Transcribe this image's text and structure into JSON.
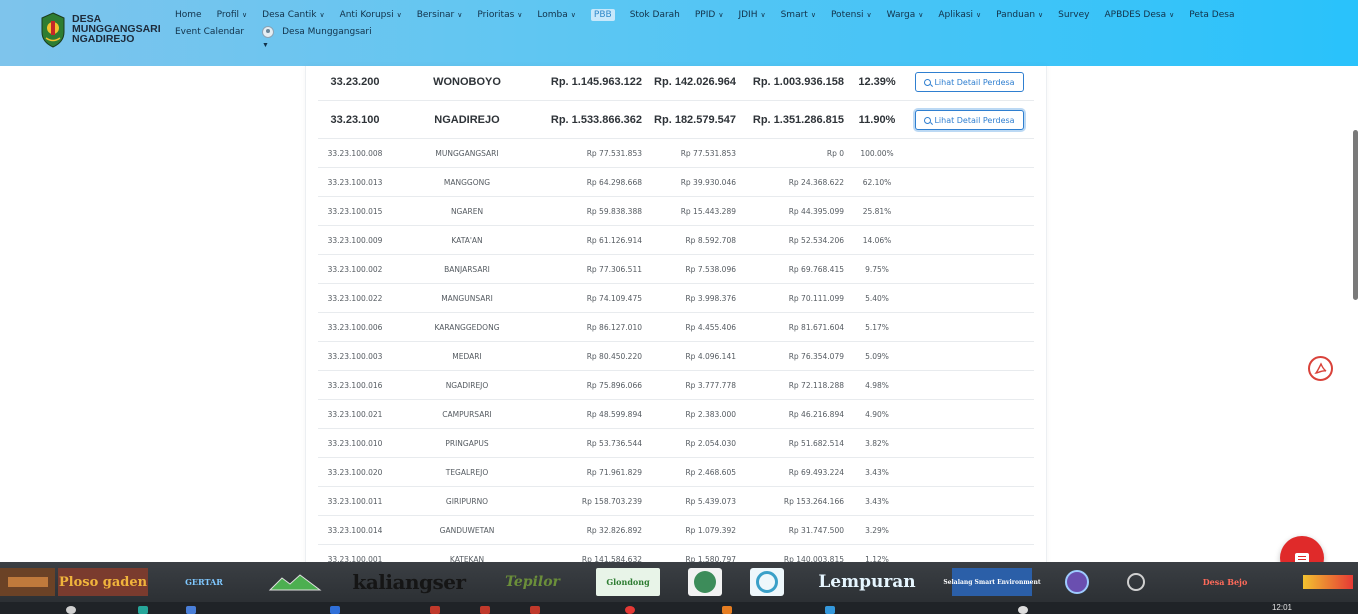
{
  "header": {
    "brand": [
      "DESA",
      "MUNGGANGSARI",
      "NGADIREJO"
    ],
    "nav": [
      {
        "label": "Home",
        "caret": false
      },
      {
        "label": "Profil",
        "caret": true
      },
      {
        "label": "Desa Cantik",
        "caret": true
      },
      {
        "label": "Anti Korupsi",
        "caret": true
      },
      {
        "label": "Bersinar",
        "caret": true
      },
      {
        "label": "Prioritas",
        "caret": true
      },
      {
        "label": "Lomba",
        "caret": true
      },
      {
        "label": "PBB",
        "caret": false,
        "active": true
      },
      {
        "label": "Stok Darah",
        "caret": false
      },
      {
        "label": "PPID",
        "caret": true
      },
      {
        "label": "JDIH",
        "caret": true
      },
      {
        "label": "Smart",
        "caret": true
      },
      {
        "label": "Potensi",
        "caret": true
      },
      {
        "label": "Warga",
        "caret": true
      },
      {
        "label": "Aplikasi",
        "caret": true
      },
      {
        "label": "Panduan",
        "caret": true
      },
      {
        "label": "Survey",
        "caret": false
      },
      {
        "label": "APBDES Desa",
        "caret": true
      },
      {
        "label": "Peta Desa",
        "caret": false
      },
      {
        "label": "Event Calendar",
        "caret": false
      }
    ],
    "user": "Desa Munggangsari"
  },
  "table": {
    "big_rows": [
      {
        "kode": "33.23.200",
        "nama": "WONOBOYO",
        "pagu": "Rp. 1.145.963.122",
        "realisasi": "Rp. 142.026.964",
        "sisa": "Rp. 1.003.936.158",
        "persen": "12.39%",
        "button": "Lihat Detail Perdesa",
        "focused": false
      },
      {
        "kode": "33.23.100",
        "nama": "NGADIREJO",
        "pagu": "Rp. 1.533.866.362",
        "realisasi": "Rp. 182.579.547",
        "sisa": "Rp. 1.351.286.815",
        "persen": "11.90%",
        "button": "Lihat Detail Perdesa",
        "focused": true
      }
    ],
    "rows": [
      {
        "kode": "33.23.100.008",
        "nama": "MUNGGANGSARI",
        "pagu": "Rp 77.531.853",
        "realisasi": "Rp 77.531.853",
        "sisa": "Rp 0",
        "persen": "100.00%"
      },
      {
        "kode": "33.23.100.013",
        "nama": "MANGGONG",
        "pagu": "Rp 64.298.668",
        "realisasi": "Rp 39.930.046",
        "sisa": "Rp 24.368.622",
        "persen": "62.10%"
      },
      {
        "kode": "33.23.100.015",
        "nama": "NGAREN",
        "pagu": "Rp 59.838.388",
        "realisasi": "Rp 15.443.289",
        "sisa": "Rp 44.395.099",
        "persen": "25.81%"
      },
      {
        "kode": "33.23.100.009",
        "nama": "KATA'AN",
        "pagu": "Rp 61.126.914",
        "realisasi": "Rp 8.592.708",
        "sisa": "Rp 52.534.206",
        "persen": "14.06%"
      },
      {
        "kode": "33.23.100.002",
        "nama": "BANJARSARI",
        "pagu": "Rp 77.306.511",
        "realisasi": "Rp 7.538.096",
        "sisa": "Rp 69.768.415",
        "persen": "9.75%"
      },
      {
        "kode": "33.23.100.022",
        "nama": "MANGUNSARI",
        "pagu": "Rp 74.109.475",
        "realisasi": "Rp 3.998.376",
        "sisa": "Rp 70.111.099",
        "persen": "5.40%"
      },
      {
        "kode": "33.23.100.006",
        "nama": "KARANGGEDONG",
        "pagu": "Rp 86.127.010",
        "realisasi": "Rp 4.455.406",
        "sisa": "Rp 81.671.604",
        "persen": "5.17%"
      },
      {
        "kode": "33.23.100.003",
        "nama": "MEDARI",
        "pagu": "Rp 80.450.220",
        "realisasi": "Rp 4.096.141",
        "sisa": "Rp 76.354.079",
        "persen": "5.09%"
      },
      {
        "kode": "33.23.100.016",
        "nama": "NGADIREJO",
        "pagu": "Rp 75.896.066",
        "realisasi": "Rp 3.777.778",
        "sisa": "Rp 72.118.288",
        "persen": "4.98%"
      },
      {
        "kode": "33.23.100.021",
        "nama": "CAMPURSARI",
        "pagu": "Rp 48.599.894",
        "realisasi": "Rp 2.383.000",
        "sisa": "Rp 46.216.894",
        "persen": "4.90%"
      },
      {
        "kode": "33.23.100.010",
        "nama": "PRINGAPUS",
        "pagu": "Rp 53.736.544",
        "realisasi": "Rp 2.054.030",
        "sisa": "Rp 51.682.514",
        "persen": "3.82%"
      },
      {
        "kode": "33.23.100.020",
        "nama": "TEGALREJO",
        "pagu": "Rp 71.961.829",
        "realisasi": "Rp 2.468.605",
        "sisa": "Rp 69.493.224",
        "persen": "3.43%"
      },
      {
        "kode": "33.23.100.011",
        "nama": "GIRIPURNO",
        "pagu": "Rp 158.703.239",
        "realisasi": "Rp 5.439.073",
        "sisa": "Rp 153.264.166",
        "persen": "3.43%"
      },
      {
        "kode": "33.23.100.014",
        "nama": "GANDUWETAN",
        "pagu": "Rp 32.826.892",
        "realisasi": "Rp 1.079.392",
        "sisa": "Rp 31.747.500",
        "persen": "3.29%"
      },
      {
        "kode": "33.23.100.001",
        "nama": "KATEKAN",
        "pagu": "Rp 141.584.632",
        "realisasi": "Rp 1.580.797",
        "sisa": "Rp 140.003.815",
        "persen": "1.12%"
      }
    ]
  },
  "banner": {
    "logos": [
      "Ploso gaden",
      "GERTAR",
      "kaliangser",
      "Tepilor",
      "Glondong",
      "Lempuran",
      "Selalang Smart Environment",
      "Desa Bejo"
    ]
  },
  "taskbar": {
    "clock": "12:01"
  },
  "colors": {
    "header_accent": "#29c2fb",
    "button_blue": "#2f7fd0",
    "chat_red": "#e02a2a",
    "pdf_red": "#d9423a"
  }
}
